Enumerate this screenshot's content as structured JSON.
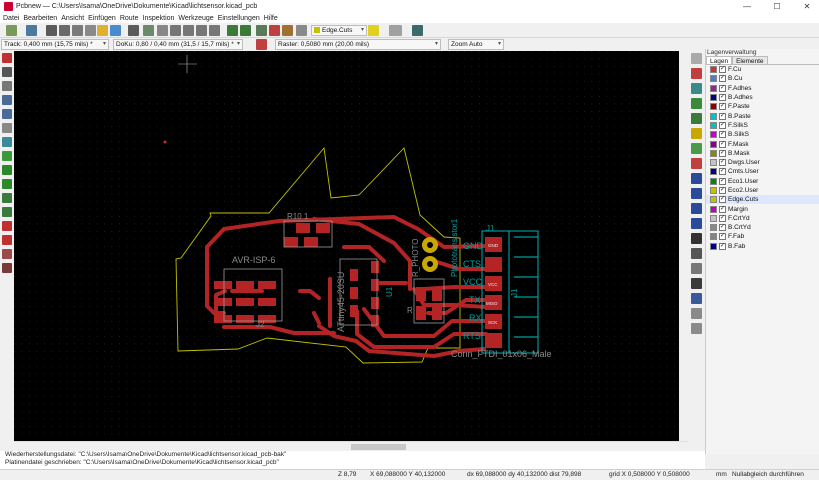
{
  "window": {
    "title": "Pcbnew — C:\\Users\\Isama\\OneDrive\\Dokumente\\Kicad\\lichtsensor.kicad_pcb"
  },
  "menu": [
    "Datei",
    "Bearbeiten",
    "Ansicht",
    "Einfügen",
    "Route",
    "Inspektion",
    "Werkzeuge",
    "Einstellungen",
    "Hilfe"
  ],
  "toolbar": {
    "layer_select": "Edge.Cuts",
    "track_width": "Track: 0,400 mm (15,75 mils) *",
    "via_size": "DoKu: 0,80 / 0,40 mm (31,5 / 15,7 mils) *",
    "grid": "Raster: 0,5080 mm (20,00 mils)",
    "zoom": "Zoom Auto"
  },
  "layers_panel": {
    "title": "Lagenverwaltung",
    "tabs": [
      "Lagen",
      "Elemente"
    ],
    "items": [
      {
        "name": "F.Cu",
        "color": "#c83434",
        "checked": true
      },
      {
        "name": "B.Cu",
        "color": "#4d7fc4",
        "checked": true
      },
      {
        "name": "F.Adhes",
        "color": "#8a2a8a",
        "checked": true
      },
      {
        "name": "B.Adhes",
        "color": "#00008a",
        "checked": true
      },
      {
        "name": "F.Paste",
        "color": "#8a0000",
        "checked": true
      },
      {
        "name": "B.Paste",
        "color": "#00c2c2",
        "checked": true
      },
      {
        "name": "F.SilkS",
        "color": "#00c2c2",
        "checked": true
      },
      {
        "name": "B.SilkS",
        "color": "#c200c2",
        "checked": true
      },
      {
        "name": "F.Mask",
        "color": "#8a008a",
        "checked": true
      },
      {
        "name": "B.Mask",
        "color": "#8a8a00",
        "checked": true
      },
      {
        "name": "Dwgs.User",
        "color": "#c2c2c2",
        "checked": true
      },
      {
        "name": "Cmts.User",
        "color": "#00008a",
        "checked": true
      },
      {
        "name": "Eco1.User",
        "color": "#008a00",
        "checked": true
      },
      {
        "name": "Eco2.User",
        "color": "#c2c200",
        "checked": true
      },
      {
        "name": "Edge.Cuts",
        "color": "#c2c200",
        "checked": true,
        "selected": true
      },
      {
        "name": "Margin",
        "color": "#c200c2",
        "checked": true
      },
      {
        "name": "F.CrtYd",
        "color": "#c2c2c2",
        "checked": true
      },
      {
        "name": "B.CrtYd",
        "color": "#8a8a8a",
        "checked": true
      },
      {
        "name": "F.Fab",
        "color": "#848484",
        "checked": true
      },
      {
        "name": "B.Fab",
        "color": "#00008a",
        "checked": true
      }
    ]
  },
  "pcb": {
    "ref_r101": "R10 1",
    "ref_r_photo": "R_PHOTO",
    "ref_phototransistor": "Phototransistor1",
    "fp_avr": "AVR-ISP-6",
    "fp_j2": "J2",
    "fp_attiny": "ATtiny45-20SU",
    "fp_u1": "U1",
    "fp_r": "R",
    "fp_j1": "J1",
    "fp_conn": "Conn_FTDI_01x06_Male",
    "pin_labels": [
      "GND",
      "CTS",
      "VCC",
      "TX",
      "RX",
      "RTS"
    ],
    "pad_labels": [
      "GND",
      "VCC",
      "MISO",
      "SCK"
    ]
  },
  "messages": {
    "line1": "Wiederherstellungsdatei: \"C:\\Users\\Isama\\OneDrive\\Dokumente\\Kicad\\lichtsensor.kicad_pcb-bak\"",
    "line2": "Platinendatei geschrieben: \"C:\\Users\\Isama\\OneDrive\\Dokumente\\Kicad\\lichtsensor.kicad_pcb\""
  },
  "status": {
    "zoom": "Z 8,79",
    "abs_pos": "X 69,088000  Y 40,132000",
    "rel_pos": "dx 69,088000  dy 40,132000  dist 79,898",
    "grid": "grid X 0,508000  Y 0,508000",
    "units": "mm",
    "mode": "Nullabgleich durchführen"
  }
}
